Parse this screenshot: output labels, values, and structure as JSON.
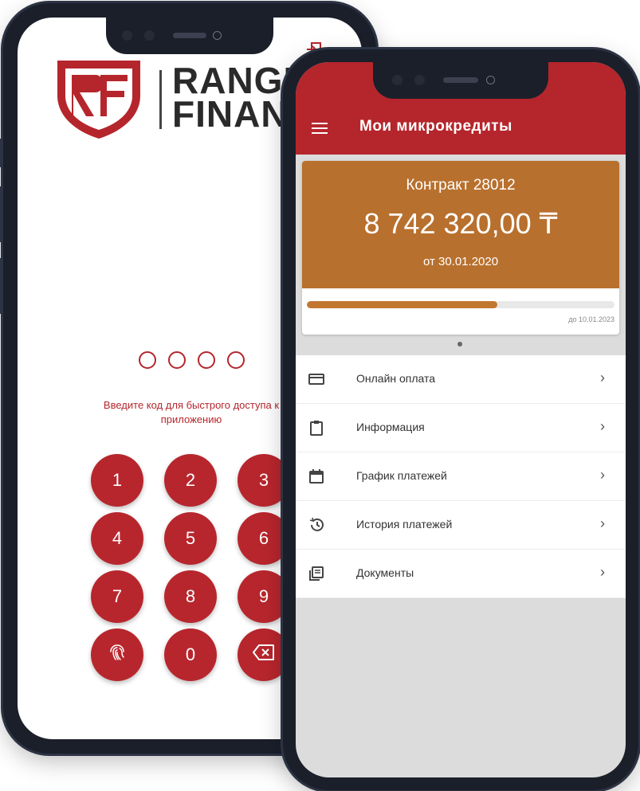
{
  "login_screen": {
    "brand_lines": [
      "RANGER",
      "FINANCE"
    ],
    "pin_prompt_line1": "Введите код для быстрого доступа к",
    "pin_prompt_line2": "приложению",
    "keypad": [
      "1",
      "2",
      "3",
      "4",
      "5",
      "6",
      "7",
      "8",
      "9",
      "0"
    ],
    "pin_length": 4
  },
  "main_screen": {
    "title": "Мои микрокредиты",
    "contract": {
      "title": "Контракт 28012",
      "amount": "8 742 320,00 ₸",
      "from_date": "от 30.01.2020",
      "until_date": "до 10.01.2023",
      "progress": 0.62
    },
    "menu": [
      {
        "icon": "credit-card-icon",
        "label": "Онлайн оплата"
      },
      {
        "icon": "clipboard-icon",
        "label": "Информация"
      },
      {
        "icon": "calendar-icon",
        "label": "График платежей"
      },
      {
        "icon": "history-icon",
        "label": "История платежей"
      },
      {
        "icon": "documents-icon",
        "label": "Документы"
      }
    ]
  },
  "colors": {
    "brand_red": "#b5262c",
    "card_orange": "#b8702e",
    "progress_orange": "#c27730"
  }
}
